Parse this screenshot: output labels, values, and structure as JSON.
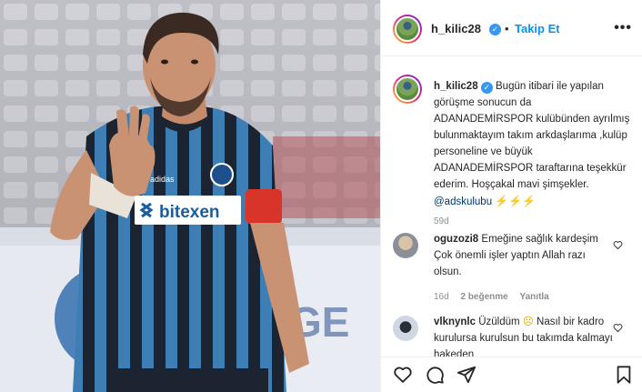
{
  "post": {
    "username": "h_kilic28",
    "verified_icon": "verified-badge-icon",
    "separator": "•",
    "follow_label": "Takip Et",
    "more_icon": "more-options-icon",
    "more_label": "•••"
  },
  "caption": {
    "username": "h_kilic28",
    "text": "Bugün itibari ile yapılan görüşme sonucun da ADANADEMİRSPOR kulübünden ayrılmış bulunmaktayım takım arkdaşlarıma ,kulüp personeline ve büyük ADANADEMİRSPOR taraftarına teşekkür ederim. Hoşçakal mavi şimşekler.",
    "mention": "@adskulubu",
    "emoji": "⚡⚡⚡",
    "time": "59d"
  },
  "comments": [
    {
      "username": "oguzozi8",
      "text": "Emeğine sağlık kardeşim Çok önemli işler yaptın Allah razı olsun.",
      "time": "16d",
      "likes": "2 beğenme",
      "reply": "Yanıtla"
    },
    {
      "username": "vlknynlc",
      "text_before": "Üzüldüm",
      "emoji": "☹",
      "text_after": "Nasıl bir kadro kurulursa kurulsun bu takımda kalmayı hakeden"
    }
  ],
  "photo": {
    "jersey_sponsor": "bitexen",
    "colors": {
      "stripe_blue": "#3d7fb4",
      "stripe_dark": "#1b2430",
      "armband": "#d8342a"
    }
  },
  "actions": {
    "like_icon": "heart-icon",
    "comment_icon": "comment-icon",
    "share_icon": "share-icon",
    "save_icon": "bookmark-icon"
  },
  "colors": {
    "accent": "#0095f6",
    "text": "#262626",
    "muted": "#8e8e8e"
  }
}
